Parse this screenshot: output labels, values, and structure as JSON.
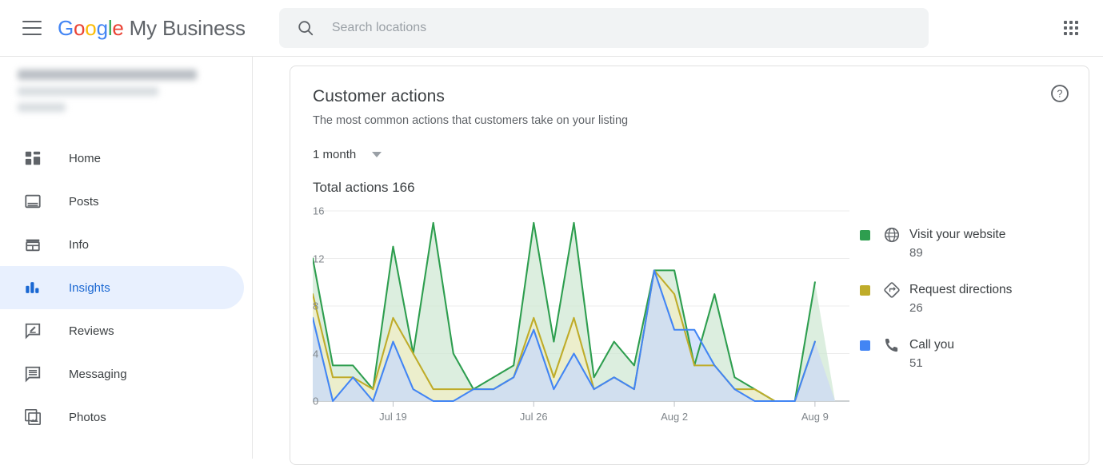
{
  "topbar": {
    "menu_icon": "hamburger-menu-icon",
    "brand_google": "Google",
    "brand_product": "My Business",
    "search_placeholder": "Search locations",
    "search_value": "",
    "search_icon": "search-icon",
    "apps_icon": "apps-grid-icon"
  },
  "sidebar": {
    "business_name_redacted": "",
    "business_address_redacted": "",
    "items": [
      {
        "label": "Home",
        "icon": "dashboard-icon",
        "active": false
      },
      {
        "label": "Posts",
        "icon": "posts-icon",
        "active": false
      },
      {
        "label": "Info",
        "icon": "storefront-icon",
        "active": false
      },
      {
        "label": "Insights",
        "icon": "bar-chart-icon",
        "active": true
      },
      {
        "label": "Reviews",
        "icon": "review-icon",
        "active": false
      },
      {
        "label": "Messaging",
        "icon": "message-icon",
        "active": false
      },
      {
        "label": "Photos",
        "icon": "photos-icon",
        "active": false
      }
    ]
  },
  "card": {
    "title": "Customer actions",
    "subtitle": "The most common actions that customers take on your listing",
    "help_icon": "help-circle-icon",
    "range_label": "1 month",
    "range_caret_icon": "chevron-down-icon",
    "total_actions": "Total actions 166"
  },
  "chart_data": {
    "type": "area",
    "title": "Customer actions",
    "xlabel": "",
    "ylabel": "",
    "ylim": [
      0,
      16
    ],
    "yticks": [
      0,
      4,
      8,
      12,
      16
    ],
    "grid": true,
    "legend_position": "right",
    "x": [
      "Jul 15",
      "Jul 16",
      "Jul 17",
      "Jul 18",
      "Jul 19",
      "Jul 20",
      "Jul 21",
      "Jul 22",
      "Jul 23",
      "Jul 24",
      "Jul 25",
      "Jul 26",
      "Jul 27",
      "Jul 28",
      "Jul 29",
      "Jul 30",
      "Jul 31",
      "Aug 1",
      "Aug 2",
      "Aug 3",
      "Aug 4",
      "Aug 5",
      "Aug 6",
      "Aug 7",
      "Aug 8",
      "Aug 9",
      "Aug 10"
    ],
    "xtick_labels": [
      "Jul 19",
      "Jul 26",
      "Aug 2",
      "Aug 9"
    ],
    "xtick_indices": [
      4,
      11,
      18,
      25
    ],
    "series": [
      {
        "name": "Visit your website",
        "total": 89,
        "color": "#2E9E4F",
        "fill": "#cfe8d3",
        "icon": "globe-icon",
        "values": [
          12,
          3,
          3,
          1,
          13,
          4,
          15,
          4,
          1,
          2,
          3,
          15,
          5,
          15,
          2,
          5,
          3,
          11,
          11,
          3,
          9,
          2,
          1,
          0,
          0,
          10
        ]
      },
      {
        "name": "Request directions",
        "total": 26,
        "color": "#BFAC2A",
        "fill": "#f3eec5",
        "icon": "directions-icon",
        "values": [
          9,
          2,
          2,
          1,
          7,
          4,
          1,
          1,
          1,
          1,
          2,
          7,
          2,
          7,
          1,
          2,
          1,
          11,
          9,
          3,
          3,
          1,
          1,
          0,
          0,
          5
        ]
      },
      {
        "name": "Call you",
        "total": 51,
        "color": "#4285F4",
        "fill": "#c6dafc",
        "icon": "phone-icon",
        "values": [
          7,
          0,
          2,
          0,
          5,
          1,
          0,
          0,
          1,
          1,
          2,
          6,
          1,
          4,
          1,
          2,
          1,
          11,
          6,
          6,
          3,
          1,
          0,
          0,
          0,
          5
        ]
      }
    ]
  }
}
